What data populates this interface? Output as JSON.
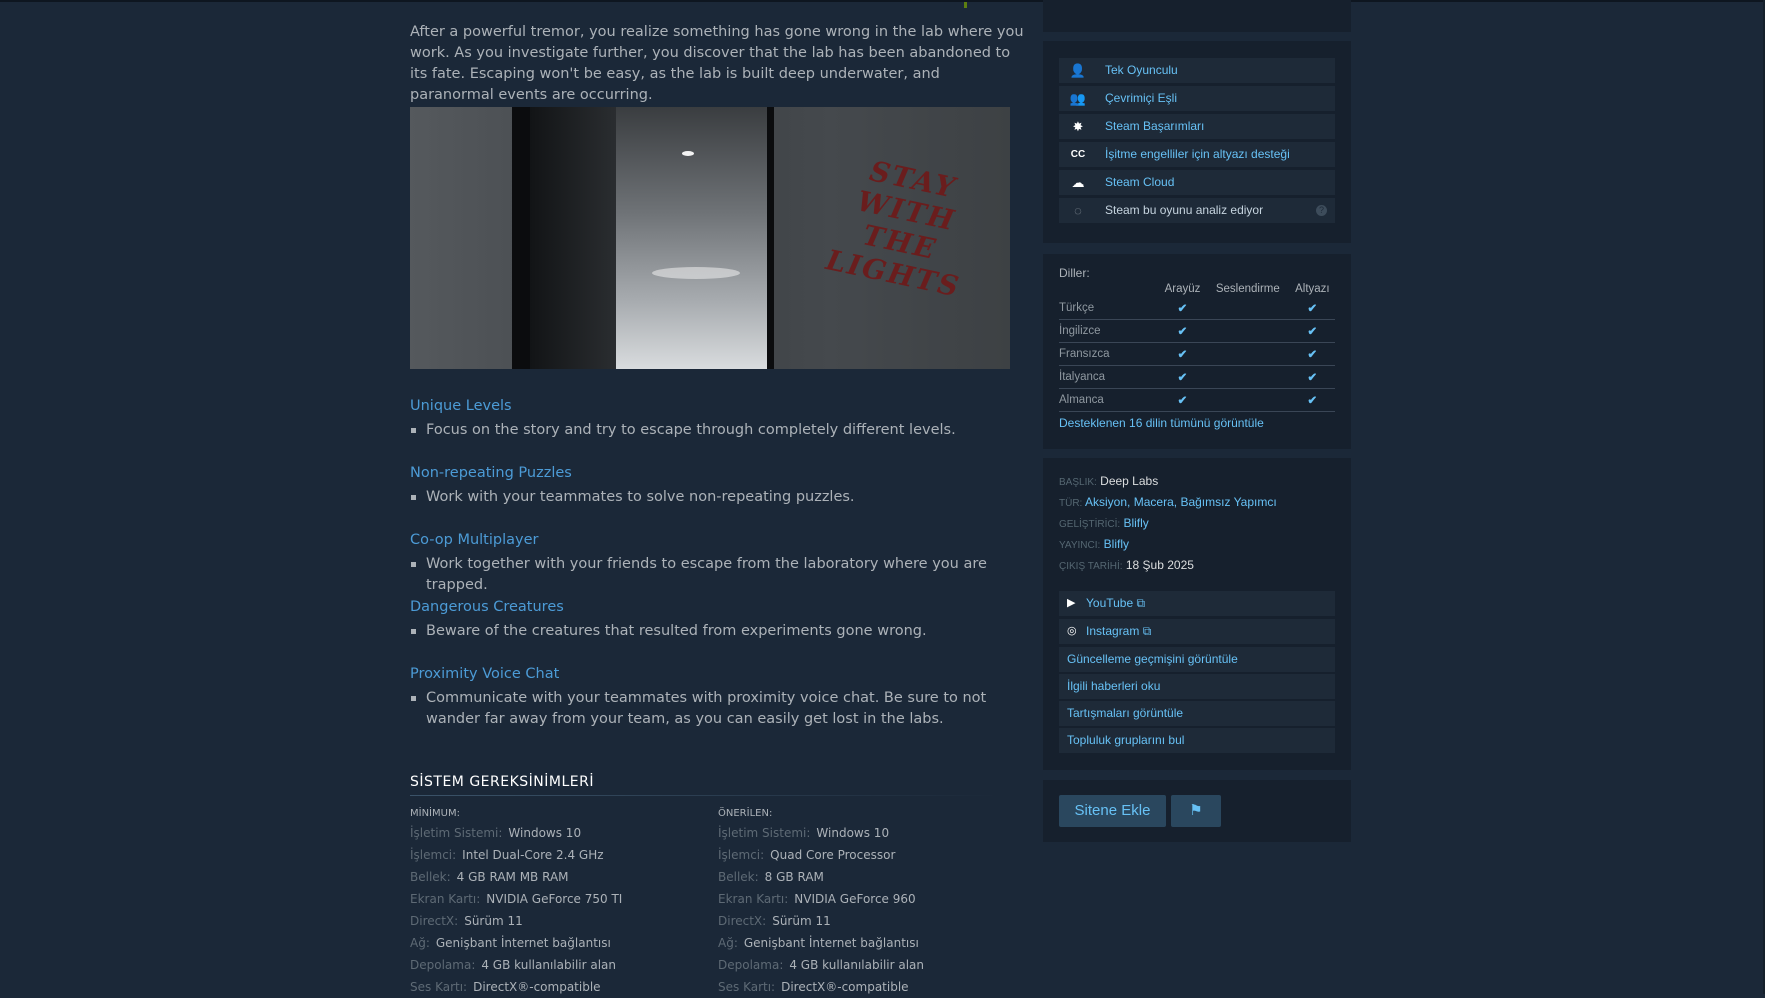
{
  "description": "After a powerful tremor, you realize something has gone wrong in the lab where you work. As you investigate further, you discover that the lab has been abandoned to its fate. Escaping won't be easy, as the lab is built deep underwater, and paranormal events are occurring.",
  "hero_graffiti": "STAY WITH THE LIGHTS",
  "features": [
    {
      "title": "Unique Levels",
      "text": "Focus on the story and try to escape through completely different levels."
    },
    {
      "title": "Non-repeating Puzzles",
      "text": "Work with your teammates to solve non-repeating puzzles."
    },
    {
      "title": "Co-op Multiplayer",
      "text": "Work together with your friends to escape from the laboratory where you are trapped."
    },
    {
      "title": "Dangerous Creatures",
      "text": "Beware of the creatures that resulted from experiments gone wrong."
    },
    {
      "title": "Proximity Voice Chat",
      "text": "Communicate with your teammates with proximity voice chat. Be sure to not wander far away from your team, as you can easily get lost in the labs."
    }
  ],
  "sysreq": {
    "heading": "SİSTEM GEREKSİNİMLERİ",
    "min": {
      "title": "MİNİMUM:",
      "rows": [
        {
          "k": "İşletim Sistemi:",
          "v": "Windows 10"
        },
        {
          "k": "İşlemci:",
          "v": "Intel Dual-Core 2.4 GHz"
        },
        {
          "k": "Bellek:",
          "v": "4 GB RAM MB RAM"
        },
        {
          "k": "Ekran Kartı:",
          "v": "NVIDIA GeForce 750 TI"
        },
        {
          "k": "DirectX:",
          "v": "Sürüm 11"
        },
        {
          "k": "Ağ:",
          "v": "Genişbant İnternet bağlantısı"
        },
        {
          "k": "Depolama:",
          "v": "4 GB kullanılabilir alan"
        },
        {
          "k": "Ses Kartı:",
          "v": "DirectX®-compatible"
        }
      ]
    },
    "rec": {
      "title": "ÖNERİLEN:",
      "rows": [
        {
          "k": "İşletim Sistemi:",
          "v": "Windows 10"
        },
        {
          "k": "İşlemci:",
          "v": "Quad Core Processor"
        },
        {
          "k": "Bellek:",
          "v": "8 GB RAM"
        },
        {
          "k": "Ekran Kartı:",
          "v": "NVIDIA GeForce 960"
        },
        {
          "k": "DirectX:",
          "v": "Sürüm 11"
        },
        {
          "k": "Ağ:",
          "v": "Genişbant İnternet bağlantısı"
        },
        {
          "k": "Depolama:",
          "v": "4 GB kullanılabilir alan"
        },
        {
          "k": "Ses Kartı:",
          "v": "DirectX®-compatible"
        }
      ]
    }
  },
  "game_features": [
    {
      "icon": "single-player-icon",
      "glyph": "👤",
      "label": "Tek Oyunculu",
      "link": true
    },
    {
      "icon": "online-coop-icon",
      "glyph": "👥",
      "label": "Çevrimiçi Eşli",
      "link": true
    },
    {
      "icon": "achievements-icon",
      "glyph": "✸",
      "label": "Steam Başarımları",
      "link": true
    },
    {
      "icon": "captions-icon",
      "glyph": "CC",
      "label": "İşitme engelliler için altyazı desteği",
      "link": true
    },
    {
      "icon": "cloud-icon",
      "glyph": "☁",
      "label": "Steam Cloud",
      "link": true
    },
    {
      "icon": "analyzing-icon",
      "glyph": "◌",
      "label": "Steam bu oyunu analiz ediyor",
      "link": false,
      "help": "?"
    }
  ],
  "languages": {
    "title": "Diller:",
    "headers": [
      "",
      "Arayüz",
      "Seslendirme",
      "Altyazı"
    ],
    "rows": [
      {
        "name": "Türkçe",
        "ui": "✔",
        "voice": "",
        "sub": "✔"
      },
      {
        "name": "İngilizce",
        "ui": "✔",
        "voice": "",
        "sub": "✔"
      },
      {
        "name": "Fransızca",
        "ui": "✔",
        "voice": "",
        "sub": "✔"
      },
      {
        "name": "İtalyanca",
        "ui": "✔",
        "voice": "",
        "sub": "✔"
      },
      {
        "name": "Almanca",
        "ui": "✔",
        "voice": "",
        "sub": "✔"
      }
    ],
    "all_link": "Desteklenen 16 dilin tümünü görüntüle"
  },
  "details": {
    "title_key": "BAŞLIK:",
    "title_val": "Deep Labs",
    "genre_key": "TÜR:",
    "genres": [
      "Aksiyon",
      "Macera",
      "Bağımsız Yapımcı"
    ],
    "dev_key": "GELİŞTİRİCİ:",
    "dev": "Blifly",
    "pub_key": "YAYINCI:",
    "pub": "Blifly",
    "date_key": "ÇIKIŞ TARİHİ:",
    "date": "18 Şub 2025"
  },
  "links": [
    {
      "icon": "youtube-icon",
      "glyph": "▶",
      "label": "YouTube ⧉"
    },
    {
      "icon": "instagram-icon",
      "glyph": "◎",
      "label": "Instagram ⧉"
    },
    {
      "label": "Güncelleme geçmişini görüntüle"
    },
    {
      "label": "İlgili haberleri oku"
    },
    {
      "label": "Tartışmaları görüntüle"
    },
    {
      "label": "Topluluk gruplarını bul"
    }
  ],
  "embed": {
    "button": "Sitene Ekle",
    "flag_glyph": "⚑"
  }
}
